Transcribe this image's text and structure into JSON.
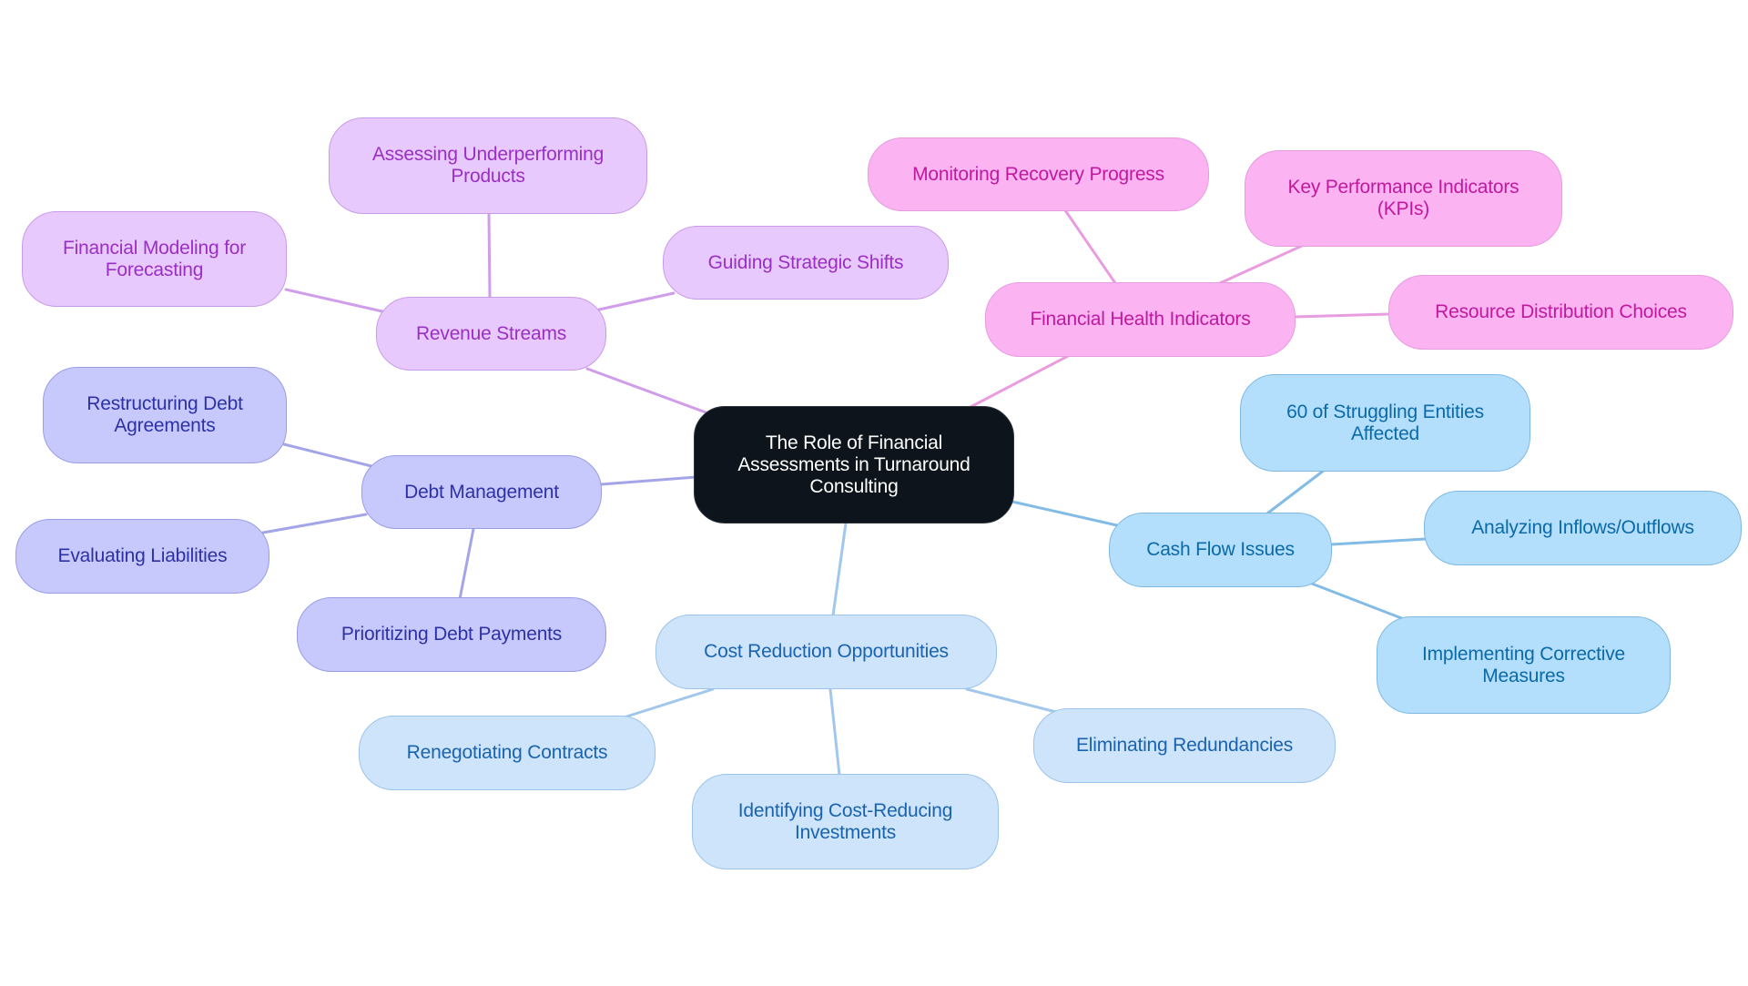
{
  "diagram": {
    "type": "mindmap",
    "root": {
      "id": "root",
      "label": "The Role of Financial Assessments in Turnaround Consulting"
    },
    "branches": [
      {
        "id": "revenue",
        "label": "Revenue Streams",
        "theme": "purple",
        "children": [
          {
            "id": "assessing",
            "label": "Assessing Underperforming Products"
          },
          {
            "id": "modeling",
            "label": "Financial Modeling for Forecasting"
          },
          {
            "id": "guiding",
            "label": "Guiding Strategic Shifts"
          }
        ]
      },
      {
        "id": "debt",
        "label": "Debt Management",
        "theme": "indigo",
        "children": [
          {
            "id": "restructuring",
            "label": "Restructuring Debt Agreements"
          },
          {
            "id": "evaluating",
            "label": "Evaluating Liabilities"
          },
          {
            "id": "prioritizing",
            "label": "Prioritizing Debt Payments"
          }
        ]
      },
      {
        "id": "health",
        "label": "Financial Health Indicators",
        "theme": "pink",
        "children": [
          {
            "id": "monitoring",
            "label": "Monitoring Recovery Progress"
          },
          {
            "id": "kpi",
            "label": "Key Performance Indicators (KPIs)"
          },
          {
            "id": "resource",
            "label": "Resource Distribution Choices"
          }
        ]
      },
      {
        "id": "cashflow",
        "label": "Cash Flow Issues",
        "theme": "sky",
        "children": [
          {
            "id": "struggling",
            "label": "60 of Struggling Entities Affected"
          },
          {
            "id": "analyzing",
            "label": "Analyzing Inflows/Outflows"
          },
          {
            "id": "implementing",
            "label": "Implementing Corrective Measures"
          }
        ]
      },
      {
        "id": "cost",
        "label": "Cost Reduction Opportunities",
        "theme": "lightblue",
        "children": [
          {
            "id": "renegotiating",
            "label": "Renegotiating Contracts"
          },
          {
            "id": "identifying",
            "label": "Identifying Cost-Reducing Investments"
          },
          {
            "id": "eliminating",
            "label": "Eliminating Redundancies"
          }
        ]
      }
    ],
    "theme_colors": {
      "root": {
        "fill": "#0d141b",
        "text": "#ffffff"
      },
      "purple": {
        "fill": "#e8c9fd",
        "stroke": "#c99be8",
        "text": "#9a2fc6",
        "edge": "#cf9de9"
      },
      "indigo": {
        "fill": "#c7c9fd",
        "stroke": "#9a9ce6",
        "text": "#2d31a6",
        "edge": "#a3a5e8"
      },
      "pink": {
        "fill": "#fbb3f2",
        "stroke": "#e79be0",
        "text": "#c0199e",
        "edge": "#e99de0"
      },
      "sky": {
        "fill": "#b3defc",
        "stroke": "#7fb9e3",
        "text": "#0b6aa8",
        "edge": "#82bce6"
      },
      "lightblue": {
        "fill": "#cde4fb",
        "stroke": "#9cc3ea",
        "text": "#1a63b0",
        "edge": "#a2c7ec"
      }
    }
  }
}
